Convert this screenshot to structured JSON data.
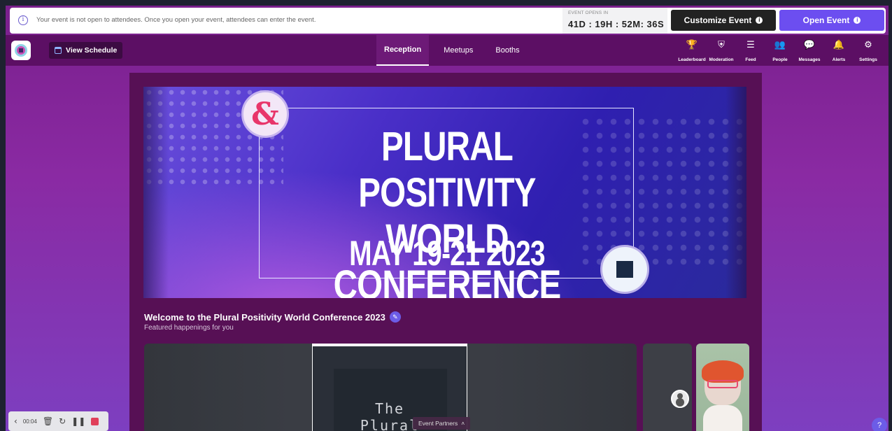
{
  "notice": {
    "message": "Your event is not open to attendees. Once you open your event, attendees can enter the event.",
    "countdown_label": "EVENT OPENS IN",
    "countdown_value": "41D : 19H : 52M: 36S",
    "customize_label": "Customize Event",
    "open_label": "Open Event"
  },
  "nav": {
    "view_schedule": "View Schedule",
    "tabs": [
      "Reception",
      "Meetups",
      "Booths"
    ],
    "icons": [
      {
        "label": "Leaderboard",
        "icon": "trophy-icon",
        "glyph": "🏆"
      },
      {
        "label": "Moderation",
        "icon": "shield-icon",
        "glyph": "⛨"
      },
      {
        "label": "Feed",
        "icon": "feed-icon",
        "glyph": "☰"
      },
      {
        "label": "People",
        "icon": "people-icon",
        "glyph": "👥"
      },
      {
        "label": "Messages",
        "icon": "messages-icon",
        "glyph": "💬"
      },
      {
        "label": "Alerts",
        "icon": "bell-icon",
        "glyph": "🔔"
      },
      {
        "label": "Settings",
        "icon": "gear-icon",
        "glyph": "⚙"
      }
    ]
  },
  "banner": {
    "title_line1": "PLURAL POSITIVITY",
    "title_line2": "WORLD CONFERENCE",
    "date": "MAY 19-21 2023"
  },
  "welcome": {
    "title": "Welcome to the Plural Positivity World Conference 2023",
    "subtitle": "Featured happenings for you"
  },
  "video": {
    "plural_line1": "The",
    "plural_line2": "Plural",
    "event_partners": "Event Partners"
  },
  "recorder": {
    "time": "00:04"
  },
  "colors": {
    "accent": "#6c4ef0",
    "nav_bg": "#5c0f64",
    "panel_bg": "#571055"
  }
}
